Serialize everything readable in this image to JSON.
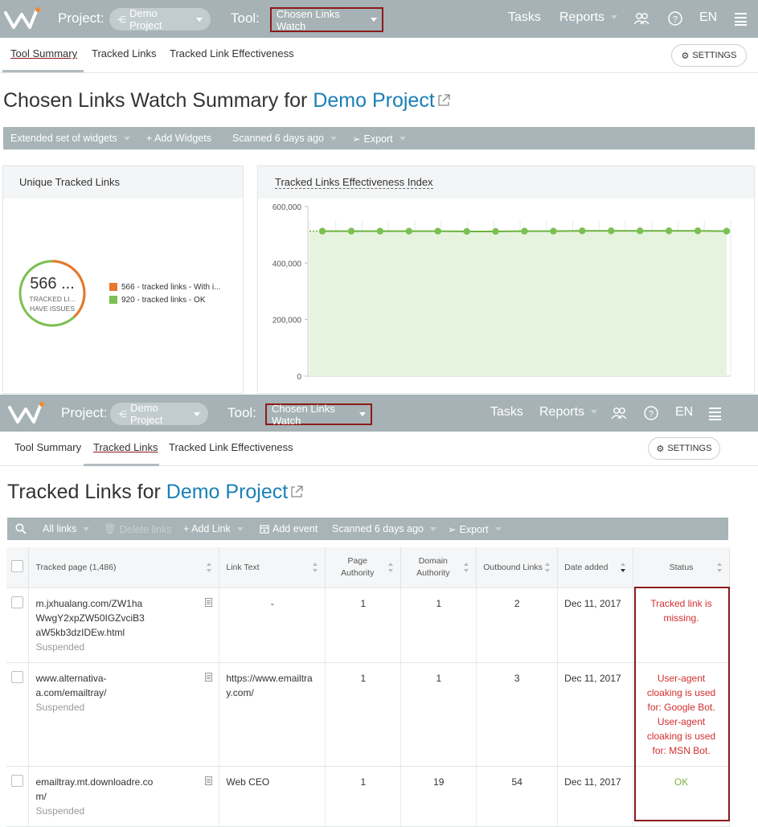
{
  "top": {
    "project_label": "Project:",
    "project_value": "Demo Project",
    "tool_label": "Tool:",
    "tool_value": "Chosen Links Watch",
    "nav_tasks": "Tasks",
    "nav_reports": "Reports",
    "lang": "EN",
    "tabs": [
      "Tool Summary",
      "Tracked Links",
      "Tracked Link Effectiveness"
    ],
    "settings": "SETTINGS",
    "title_prefix": "Chosen Links Watch Summary for",
    "title_link": "Demo Project",
    "toolbar": {
      "widgets": "Extended set of widgets",
      "add_widgets": "+ Add Widgets",
      "scanned": "Scanned 6 days ago",
      "export": "Export"
    },
    "unique_widget": {
      "title": "Unique Tracked Links",
      "value": "566 ...",
      "sub1": "TRACKED LI...",
      "sub2": "HAVE ISSUES",
      "legend": [
        {
          "text": "566 - tracked links - With i...",
          "color": "#e8762c"
        },
        {
          "text": "920 - tracked links - OK",
          "color": "#7cbf52"
        }
      ]
    },
    "effect_widget": {
      "title": "Tracked Links Effectiveness Index"
    }
  },
  "chart_data": {
    "type": "area",
    "title": "Tracked Links Effectiveness Index",
    "yticks": [
      "600,000",
      "400,000",
      "200,000",
      "0"
    ],
    "ylim": [
      0,
      600000
    ],
    "x": [
      1,
      2,
      3,
      4,
      5,
      6,
      7,
      8,
      9,
      10,
      11,
      12,
      13,
      14,
      15
    ],
    "series": [
      {
        "values": [
          513000,
          513000,
          513000,
          513000,
          513000,
          512000,
          512000,
          513000,
          513000,
          514000,
          514000,
          514000,
          514000,
          514000,
          513000
        ]
      }
    ],
    "grid": true,
    "legend": "none"
  },
  "bottom": {
    "project_label": "Project:",
    "project_value": "Demo Project",
    "tool_label": "Tool:",
    "tool_value": "Chosen Links Watch",
    "nav_tasks": "Tasks",
    "nav_reports": "Reports",
    "lang": "EN",
    "tabs": [
      "Tool Summary",
      "Tracked Links",
      "Tracked Link Effectiveness"
    ],
    "settings": "SETTINGS",
    "title_prefix": "Tracked Links for",
    "title_link": "Demo Project",
    "toolbar": {
      "all_links": "All links",
      "delete_links": "Delete links",
      "add_link": "+ Add Link",
      "add_event": "Add event",
      "scanned": "Scanned 6 days ago",
      "export": "Export"
    },
    "columns": [
      "Tracked page (1,486)",
      "Link Text",
      "Page Authority",
      "Domain Authority",
      "Outbound Links",
      "Date added",
      "Status"
    ],
    "rows": [
      {
        "page": "m.jxhualang.com/ZW1haWwgY2xpZW50IGZvciB3aW5kb3dzIDEw.html",
        "page_lines": [
          "m.jxhualang.com/ZW1ha",
          "WwgY2xpZW50IGZvciB3",
          "aW5kb3dzIDEw.html"
        ],
        "sub": "Suspended",
        "link_text": "-",
        "pa": "1",
        "da": "1",
        "out": "2",
        "date": "Dec 11, 2017",
        "status": "Tracked link is missing.",
        "status_lines": [
          "Tracked link is",
          "missing."
        ],
        "status_color": "#d22e2e"
      },
      {
        "page": "www.alternativa-a.com/emailtray/",
        "page_lines": [
          "www.alternativa-",
          "a.com/emailtray/"
        ],
        "sub": "Suspended",
        "link_text": "https://www.emailtray.com/",
        "link_lines": [
          "https://www.emailtra",
          "y.com/"
        ],
        "pa": "1",
        "da": "1",
        "out": "3",
        "date": "Dec 11, 2017",
        "status_lines": [
          "User-agent",
          "cloaking is used",
          "for: Google Bot.",
          "User-agent",
          "cloaking is used",
          "for: MSN Bot."
        ],
        "status_color": "#d22e2e"
      },
      {
        "page": "emailtray.mt.downloadre.com/",
        "page_lines": [
          "emailtray.mt.downloadre.co",
          "m/"
        ],
        "sub": "Suspended",
        "link_text": "Web CEO",
        "pa": "1",
        "da": "19",
        "out": "54",
        "date": "Dec 11, 2017",
        "status": "OK",
        "status_lines": [
          "OK"
        ],
        "status_color": "#7cb342"
      }
    ]
  }
}
